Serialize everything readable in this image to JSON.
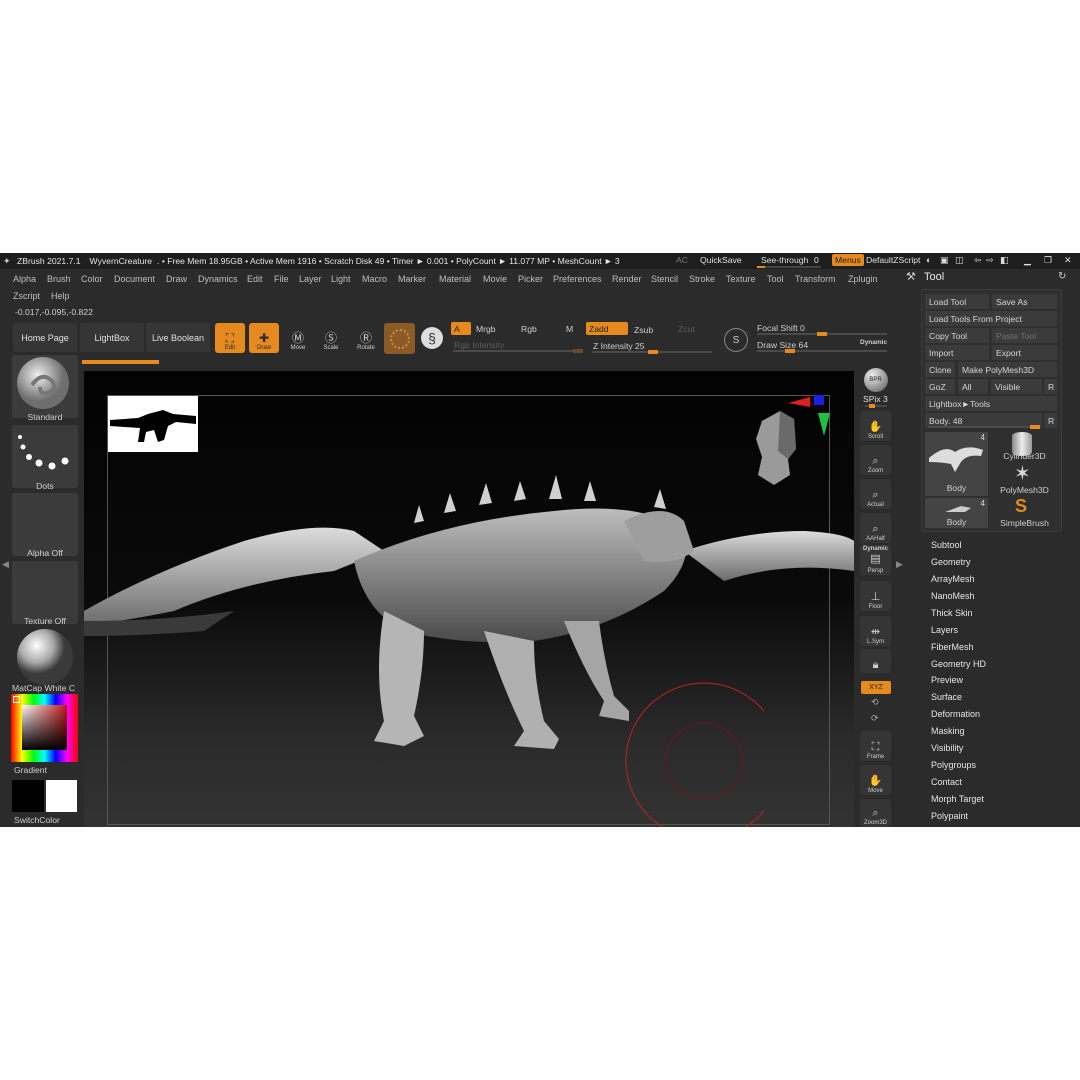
{
  "titlebar": {
    "app": "ZBrush 2021.7.1",
    "document": "WyvernCreature",
    "stats": ". • Free Mem 18.95GB • Active Mem 1916 • Scratch Disk 49 • Timer ► 0.001 • PolyCount ► 11.077 MP • MeshCount ► 3",
    "ac": "AC",
    "quicksave": "QuickSave",
    "see_through": "See-through",
    "see_through_value": "0",
    "menus": "Menus",
    "script": "DefaultZScript"
  },
  "menus": [
    "Alpha",
    "Brush",
    "Color",
    "Document",
    "Draw",
    "Dynamics",
    "Edit",
    "File",
    "Layer",
    "Light",
    "Macro",
    "Marker",
    "Material",
    "Movie",
    "Picker",
    "Preferences",
    "Render",
    "Stencil",
    "Stroke",
    "Texture",
    "Tool",
    "Transform",
    "Zplugin",
    "Zscript",
    "Help"
  ],
  "coords": "-0.017,-0.095,-0.822",
  "toolbar": {
    "home_page": "Home Page",
    "lightbox": "LightBox",
    "live_boolean": "Live Boolean",
    "edit": "Edit",
    "draw": "Draw",
    "move": "Move",
    "scale": "Scale",
    "rotate": "Rotate",
    "a": "A",
    "mrgb": "Mrgb",
    "rgb": "Rgb",
    "m": "M",
    "zadd": "Zadd",
    "zsub": "Zsub",
    "zcut": "Zcut",
    "rgb_intensity": "Rgb Intensity",
    "z_intensity": "Z Intensity 25",
    "focal_shift": "Focal Shift 0",
    "draw_size": "Draw Size 64",
    "dynamic": "Dynamic"
  },
  "left_shelf": {
    "brush": "Standard",
    "stroke": "Dots",
    "alpha": "Alpha Off",
    "texture": "Texture Off",
    "material": "MatCap White C",
    "gradient": "Gradient",
    "switch_color": "SwitchColor"
  },
  "right_shelf": {
    "bpr": "BPR",
    "spix": "SPix 3",
    "scroll": "Scroll",
    "zoom": "Zoom",
    "actual": "Actual",
    "aahalf": "AAHalf",
    "persp_top": "Dynamic",
    "persp": "Persp",
    "floor": "Floor",
    "lsym": "L.Sym",
    "xyz": "XYZ",
    "frame": "Frame",
    "move": "Move",
    "zoom3d": "Zoom3D"
  },
  "tool_panel": {
    "title": "Tool",
    "load_tool": "Load Tool",
    "save_as": "Save As",
    "load_from_project": "Load Tools From Project",
    "copy_tool": "Copy Tool",
    "paste_tool": "Paste Tool",
    "import": "Import",
    "export": "Export",
    "clone": "Clone",
    "make_polymesh": "Make PolyMesh3D",
    "goz": "GoZ",
    "all": "All",
    "visible": "Visible",
    "r": "R",
    "lightbox_tools": "Lightbox►Tools",
    "body_slider": "Body. 48",
    "thumbs": [
      {
        "label": "Body",
        "count": "4"
      },
      {
        "label": "Cylinder3D",
        "count": ""
      },
      {
        "label": "PolyMesh3D",
        "count": ""
      },
      {
        "label": "Body",
        "count": "4"
      },
      {
        "label": "SimpleBrush",
        "count": ""
      }
    ]
  },
  "subpalettes": [
    "Subtool",
    "Geometry",
    "ArrayMesh",
    "NanoMesh",
    "Thick Skin",
    "Layers",
    "FiberMesh",
    "Geometry HD",
    "Preview",
    "Surface",
    "Deformation",
    "Masking",
    "Visibility",
    "Polygroups",
    "Contact",
    "Morph Target",
    "Polypaint"
  ]
}
